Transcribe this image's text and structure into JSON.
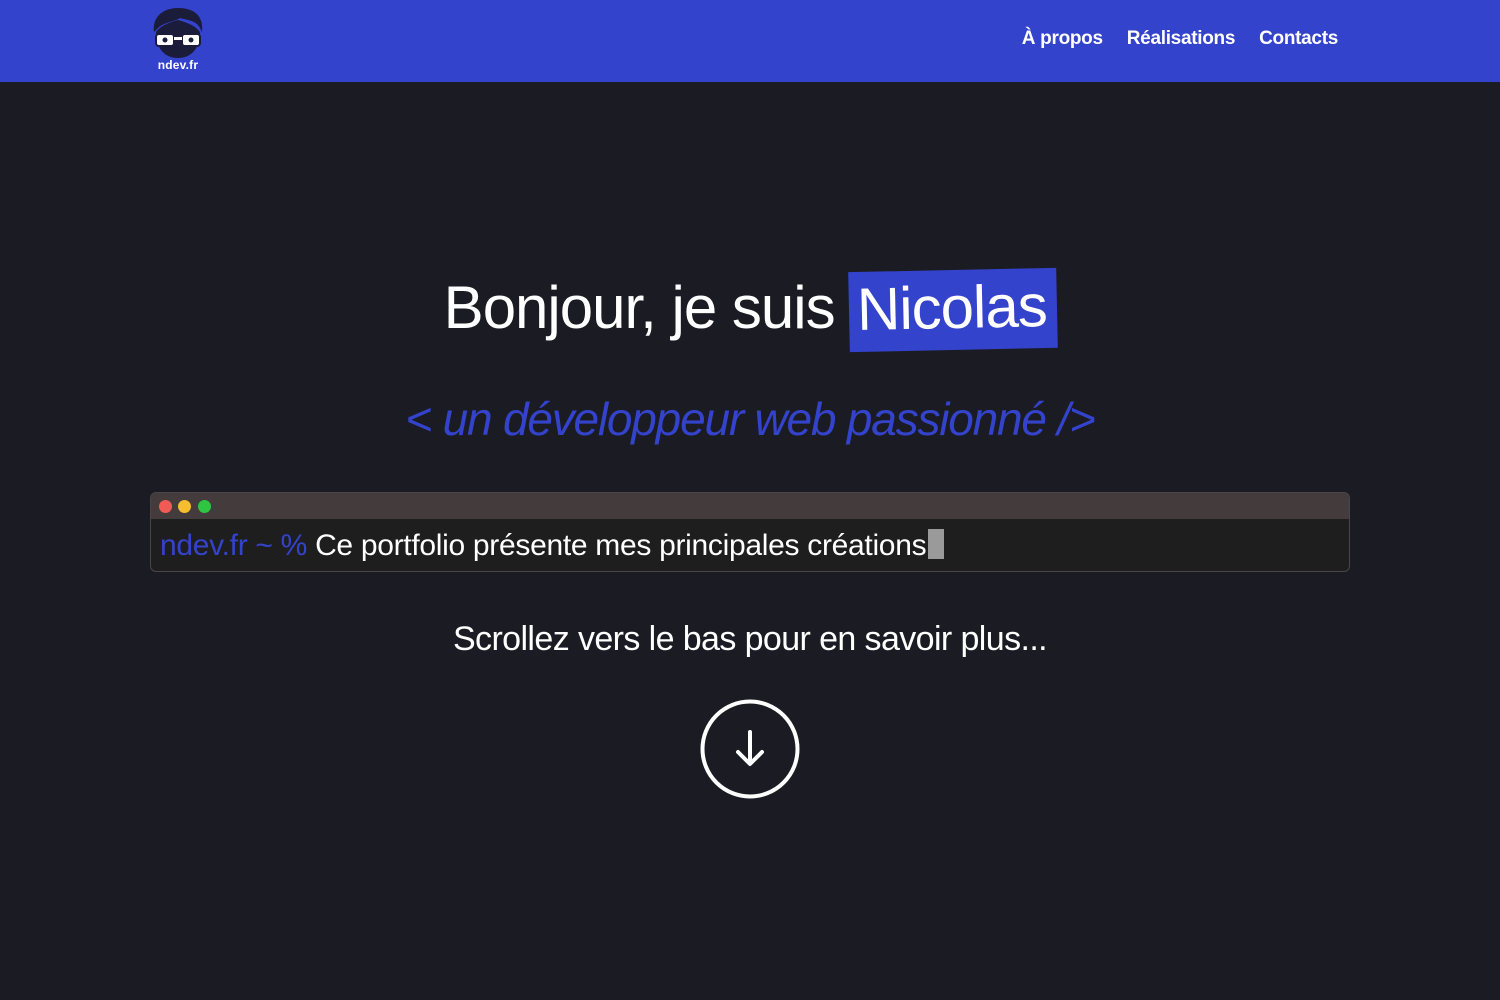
{
  "header": {
    "logo_text": "ndev.fr",
    "nav": [
      {
        "label": "À propos"
      },
      {
        "label": "Réalisations"
      },
      {
        "label": "Contacts"
      }
    ]
  },
  "hero": {
    "greeting": "Bonjour, je suis",
    "name": "Nicolas",
    "subtitle": "< un développeur web passionné />"
  },
  "terminal": {
    "prompt": "ndev.fr ~ %",
    "text": "Ce portfolio présente mes principales créations"
  },
  "scroll": {
    "text": "Scrollez vers le bas pour en savoir plus..."
  },
  "colors": {
    "accent": "#3443cb",
    "background": "#1b1b23",
    "terminal_bar": "#443c3c"
  },
  "icons": {
    "logo": "avatar-with-glasses-icon",
    "scroll": "arrow-down-circle-icon"
  }
}
